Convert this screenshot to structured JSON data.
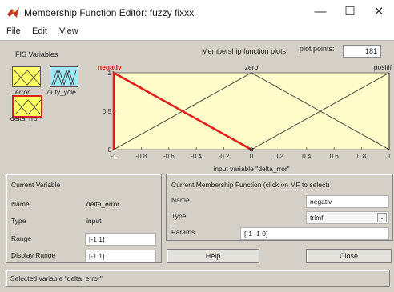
{
  "window": {
    "title": "Membership Function Editor: fuzzy fixxx",
    "controls": {
      "minimize": "—",
      "maximize": "☐",
      "close": "✕"
    }
  },
  "menu": [
    "File",
    "Edit",
    "View"
  ],
  "fis_variables": {
    "label": "FIS Variables",
    "inputs": [
      "error",
      "delta_rror"
    ],
    "outputs": [
      "duty_ycle"
    ],
    "selected": "delta_rror"
  },
  "plot": {
    "header_label": "Membership function plots",
    "points_label": "plot points:",
    "points_value": "181",
    "xlabel": "input variable \"delta_rror\"",
    "x_range": [
      -1,
      1
    ],
    "y_range": [
      0,
      1
    ],
    "x_ticks": [
      "-1",
      "-0.8",
      "-0.6",
      "-0.4",
      "-0.2",
      "0",
      "0.2",
      "0.4",
      "0.6",
      "0.8",
      "1"
    ],
    "y_ticks": [
      "0",
      "0.5",
      "1"
    ],
    "mf_names": [
      "negativ",
      "zero",
      "positif"
    ],
    "colors": {
      "background": "#fefcc8",
      "selected": "#e02020",
      "line": "#333333"
    }
  },
  "chart_data": {
    "type": "line",
    "xlabel": "input variable \"delta_rror\"",
    "ylabel": "",
    "xlim": [
      -1,
      1
    ],
    "ylim": [
      0,
      1
    ],
    "series": [
      {
        "name": "negativ",
        "x": [
          -1,
          -1,
          0
        ],
        "y": [
          0,
          1,
          0
        ],
        "selected": true
      },
      {
        "name": "zero",
        "x": [
          -1,
          0,
          1
        ],
        "y": [
          0,
          1,
          0
        ]
      },
      {
        "name": "positif",
        "x": [
          0,
          1,
          1
        ],
        "y": [
          0,
          1,
          0
        ]
      }
    ]
  },
  "current_variable": {
    "title": "Current Variable",
    "name_label": "Name",
    "name_value": "delta_error",
    "type_label": "Type",
    "type_value": "input",
    "range_label": "Range",
    "range_value": "[-1 1]",
    "display_range_label": "Display Range",
    "display_range_value": "[-1 1]"
  },
  "current_mf": {
    "title": "Current Membership Function (click on MF to select)",
    "name_label": "Name",
    "name_value": "negativ",
    "type_label": "Type",
    "type_value": "trimf",
    "params_label": "Params",
    "params_value": "[-1 -1 0]"
  },
  "buttons": {
    "help": "Help",
    "close": "Close"
  },
  "status": "Selected variable \"delta_error\""
}
